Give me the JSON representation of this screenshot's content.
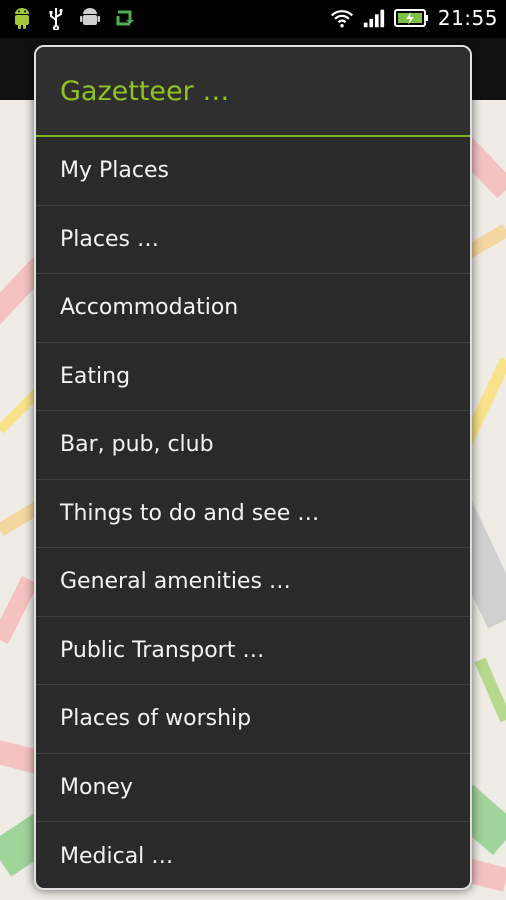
{
  "status_bar": {
    "time": "21:55",
    "left_icons": [
      "android-icon",
      "usb-icon",
      "android-debug-icon",
      "sync-icon"
    ],
    "right_icons": [
      "wifi-icon",
      "signal-icon",
      "battery-charging-icon"
    ]
  },
  "colors": {
    "accent": "#8fc31f",
    "dialog_bg": "#2a2a2a",
    "dialog_border": "#e0e0e0",
    "item_text": "#f2f2f2"
  },
  "dialog": {
    "title": "Gazetteer …",
    "items": [
      {
        "label": "My Places"
      },
      {
        "label": "Places …"
      },
      {
        "label": "Accommodation"
      },
      {
        "label": "Eating"
      },
      {
        "label": "Bar, pub, club"
      },
      {
        "label": "Things to do and see …"
      },
      {
        "label": "General amenities …"
      },
      {
        "label": "Public Transport …"
      },
      {
        "label": "Places of worship"
      },
      {
        "label": "Money"
      },
      {
        "label": "Medical …"
      }
    ]
  }
}
